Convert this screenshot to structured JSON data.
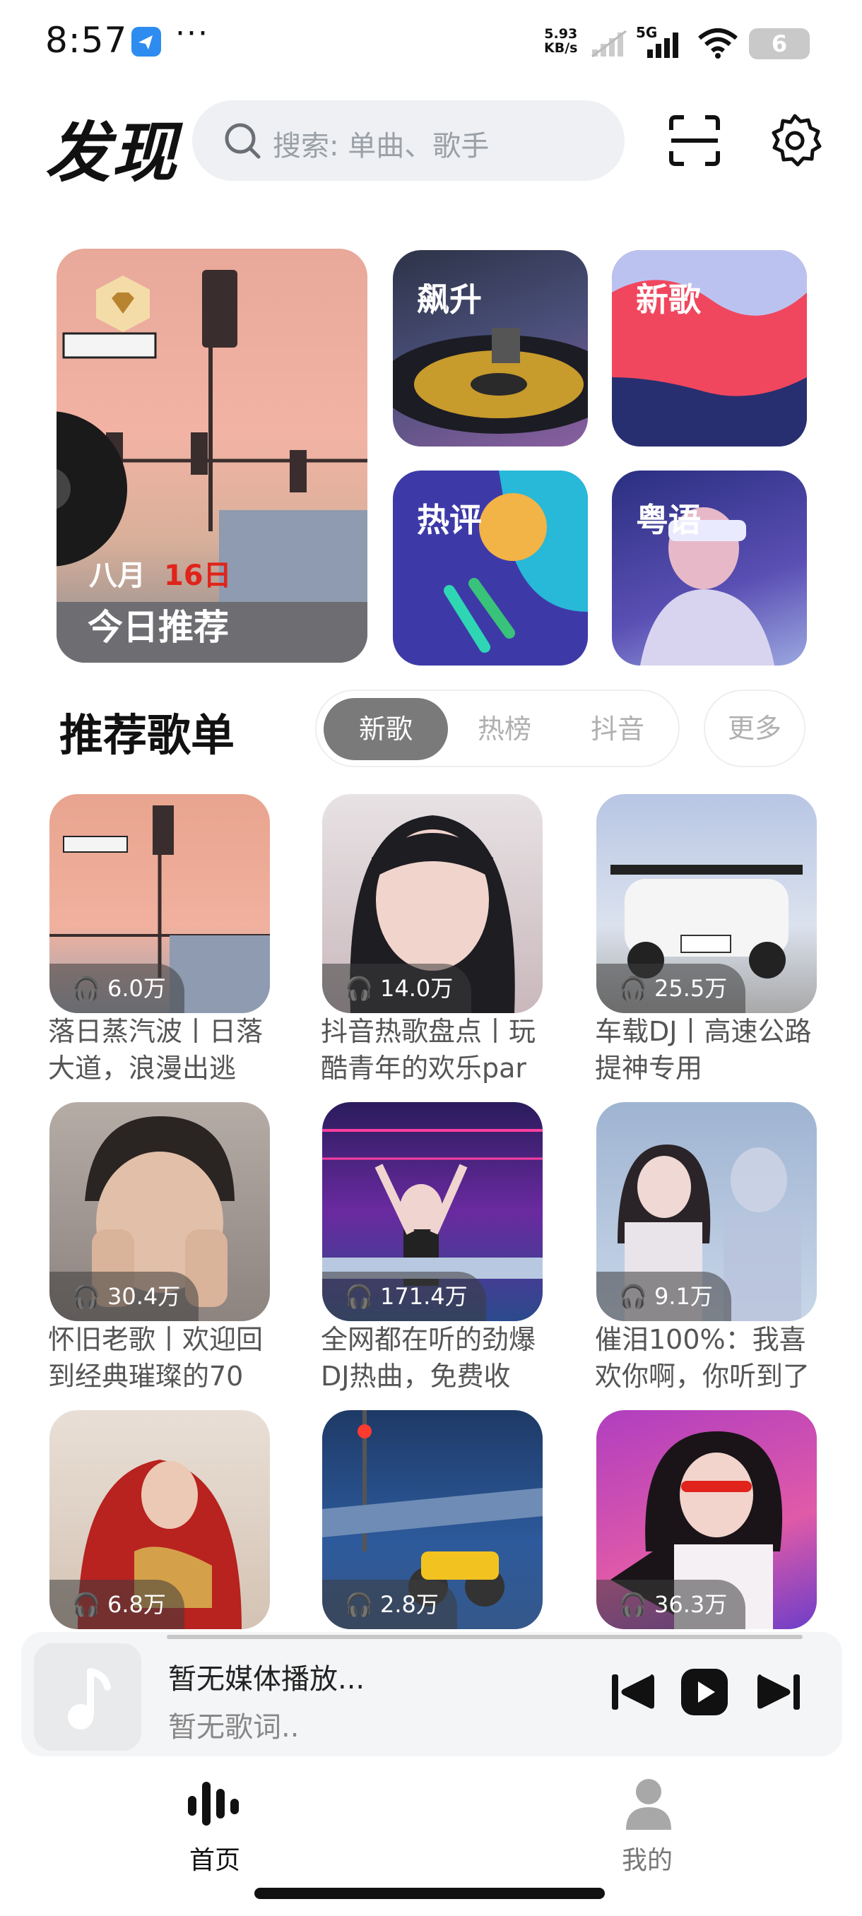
{
  "status_bar": {
    "time": "8:57",
    "more": "···",
    "net_speed": "5.93",
    "net_unit": "KB/s",
    "signal": "5G",
    "battery": "6"
  },
  "header": {
    "title": "发现",
    "search_placeholder": "搜索: 单曲、歌手"
  },
  "featured": {
    "daily": {
      "month": "八月",
      "day": "16日",
      "label": "今日推荐"
    },
    "tiles": [
      {
        "label": "飙升"
      },
      {
        "label": "新歌"
      },
      {
        "label": "热评"
      },
      {
        "label": "粤语"
      }
    ]
  },
  "section": {
    "title": "推荐歌单",
    "tabs": [
      "新歌",
      "热榜",
      "抖音"
    ],
    "active_tab": "新歌",
    "more": "更多"
  },
  "playlists": [
    {
      "count": "6.0万",
      "title": "落日蒸汽波丨日落大道，浪漫出逃"
    },
    {
      "count": "14.0万",
      "title": "抖音热歌盘点丨玩酷青年的欢乐par"
    },
    {
      "count": "25.5万",
      "title": "车载DJ丨高速公路提神专用"
    },
    {
      "count": "30.4万",
      "title": "怀旧老歌丨欢迎回到经典璀璨的70"
    },
    {
      "count": "171.4万",
      "title": "全网都在听的劲爆DJ热曲，免费收"
    },
    {
      "count": "9.1万",
      "title": "催泪100%：我喜欢你啊，你听到了"
    },
    {
      "count": "6.8万",
      "title": ""
    },
    {
      "count": "2.8万",
      "title": ""
    },
    {
      "count": "36.3万",
      "title": ""
    }
  ],
  "player": {
    "title": "暂无媒体播放...",
    "subtitle": "暂无歌词.."
  },
  "nav": {
    "home": "首页",
    "mine": "我的"
  }
}
